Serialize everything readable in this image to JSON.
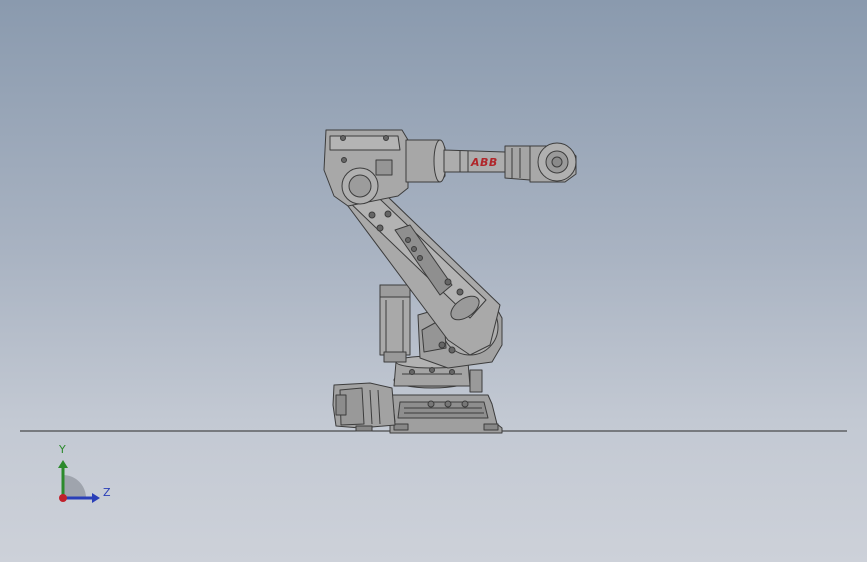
{
  "viewport": {
    "background_top": "#8a9aae",
    "background_bottom": "#cdd1d9"
  },
  "model": {
    "brand_text": "ABB",
    "brand_color": "#b0262a",
    "body_color": "#a7a7a7",
    "edge_color": "#3c3c3c",
    "floor_line_color": "#2a2a2a"
  },
  "triad": {
    "y_label": "Y",
    "z_label": "Z",
    "y_color": "#2c8a2c",
    "z_color": "#2a3fb8",
    "origin_color": "#c0202a"
  }
}
